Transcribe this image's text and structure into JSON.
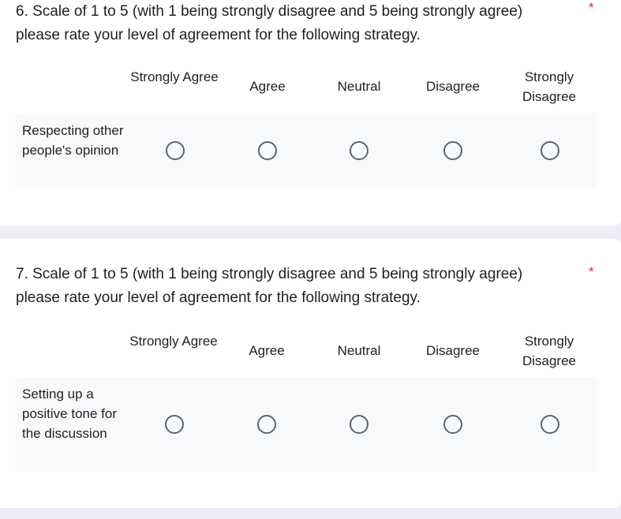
{
  "questions": [
    {
      "title": "6. Scale of 1 to 5 (with 1 being strongly disagree and 5 being strongly agree) please rate your level of agreement for the following strategy.",
      "required_mark": "*",
      "columns": [
        "Strongly Agree",
        "Agree",
        "Neutral",
        "Disagree",
        "Strongly Disagree"
      ],
      "row_label": "Respecting other people's opinion"
    },
    {
      "title": "7. Scale of 1 to 5 (with 1 being strongly disagree and 5 being strongly agree) please rate your level of agreement for the following strategy.",
      "required_mark": "*",
      "columns": [
        "Strongly Agree",
        "Agree",
        "Neutral",
        "Disagree",
        "Strongly Disagree"
      ],
      "row_label": "Setting up a positive tone for the discussion"
    }
  ],
  "colors": {
    "background": "#f0ebf8",
    "card": "#ffffff",
    "row_background": "#f8f9fa",
    "required": "#d93025",
    "radio_border": "#5f6368"
  }
}
